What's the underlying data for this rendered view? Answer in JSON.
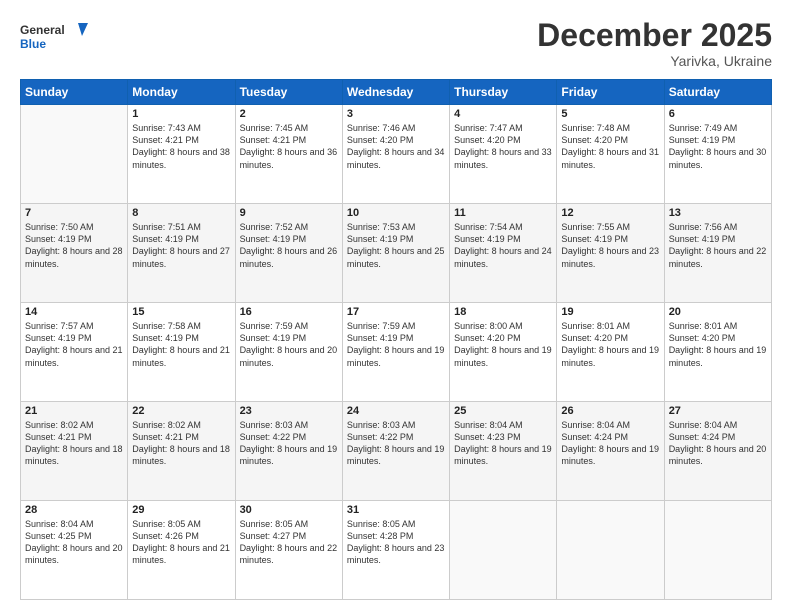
{
  "header": {
    "logo_line1": "General",
    "logo_line2": "Blue",
    "title": "December 2025",
    "subtitle": "Yarivka, Ukraine"
  },
  "days_of_week": [
    "Sunday",
    "Monday",
    "Tuesday",
    "Wednesday",
    "Thursday",
    "Friday",
    "Saturday"
  ],
  "weeks": [
    [
      {
        "day": "",
        "sunrise": "",
        "sunset": "",
        "daylight": ""
      },
      {
        "day": "1",
        "sunrise": "Sunrise: 7:43 AM",
        "sunset": "Sunset: 4:21 PM",
        "daylight": "Daylight: 8 hours and 38 minutes."
      },
      {
        "day": "2",
        "sunrise": "Sunrise: 7:45 AM",
        "sunset": "Sunset: 4:21 PM",
        "daylight": "Daylight: 8 hours and 36 minutes."
      },
      {
        "day": "3",
        "sunrise": "Sunrise: 7:46 AM",
        "sunset": "Sunset: 4:20 PM",
        "daylight": "Daylight: 8 hours and 34 minutes."
      },
      {
        "day": "4",
        "sunrise": "Sunrise: 7:47 AM",
        "sunset": "Sunset: 4:20 PM",
        "daylight": "Daylight: 8 hours and 33 minutes."
      },
      {
        "day": "5",
        "sunrise": "Sunrise: 7:48 AM",
        "sunset": "Sunset: 4:20 PM",
        "daylight": "Daylight: 8 hours and 31 minutes."
      },
      {
        "day": "6",
        "sunrise": "Sunrise: 7:49 AM",
        "sunset": "Sunset: 4:19 PM",
        "daylight": "Daylight: 8 hours and 30 minutes."
      }
    ],
    [
      {
        "day": "7",
        "sunrise": "Sunrise: 7:50 AM",
        "sunset": "Sunset: 4:19 PM",
        "daylight": "Daylight: 8 hours and 28 minutes."
      },
      {
        "day": "8",
        "sunrise": "Sunrise: 7:51 AM",
        "sunset": "Sunset: 4:19 PM",
        "daylight": "Daylight: 8 hours and 27 minutes."
      },
      {
        "day": "9",
        "sunrise": "Sunrise: 7:52 AM",
        "sunset": "Sunset: 4:19 PM",
        "daylight": "Daylight: 8 hours and 26 minutes."
      },
      {
        "day": "10",
        "sunrise": "Sunrise: 7:53 AM",
        "sunset": "Sunset: 4:19 PM",
        "daylight": "Daylight: 8 hours and 25 minutes."
      },
      {
        "day": "11",
        "sunrise": "Sunrise: 7:54 AM",
        "sunset": "Sunset: 4:19 PM",
        "daylight": "Daylight: 8 hours and 24 minutes."
      },
      {
        "day": "12",
        "sunrise": "Sunrise: 7:55 AM",
        "sunset": "Sunset: 4:19 PM",
        "daylight": "Daylight: 8 hours and 23 minutes."
      },
      {
        "day": "13",
        "sunrise": "Sunrise: 7:56 AM",
        "sunset": "Sunset: 4:19 PM",
        "daylight": "Daylight: 8 hours and 22 minutes."
      }
    ],
    [
      {
        "day": "14",
        "sunrise": "Sunrise: 7:57 AM",
        "sunset": "Sunset: 4:19 PM",
        "daylight": "Daylight: 8 hours and 21 minutes."
      },
      {
        "day": "15",
        "sunrise": "Sunrise: 7:58 AM",
        "sunset": "Sunset: 4:19 PM",
        "daylight": "Daylight: 8 hours and 21 minutes."
      },
      {
        "day": "16",
        "sunrise": "Sunrise: 7:59 AM",
        "sunset": "Sunset: 4:19 PM",
        "daylight": "Daylight: 8 hours and 20 minutes."
      },
      {
        "day": "17",
        "sunrise": "Sunrise: 7:59 AM",
        "sunset": "Sunset: 4:19 PM",
        "daylight": "Daylight: 8 hours and 19 minutes."
      },
      {
        "day": "18",
        "sunrise": "Sunrise: 8:00 AM",
        "sunset": "Sunset: 4:20 PM",
        "daylight": "Daylight: 8 hours and 19 minutes."
      },
      {
        "day": "19",
        "sunrise": "Sunrise: 8:01 AM",
        "sunset": "Sunset: 4:20 PM",
        "daylight": "Daylight: 8 hours and 19 minutes."
      },
      {
        "day": "20",
        "sunrise": "Sunrise: 8:01 AM",
        "sunset": "Sunset: 4:20 PM",
        "daylight": "Daylight: 8 hours and 19 minutes."
      }
    ],
    [
      {
        "day": "21",
        "sunrise": "Sunrise: 8:02 AM",
        "sunset": "Sunset: 4:21 PM",
        "daylight": "Daylight: 8 hours and 18 minutes."
      },
      {
        "day": "22",
        "sunrise": "Sunrise: 8:02 AM",
        "sunset": "Sunset: 4:21 PM",
        "daylight": "Daylight: 8 hours and 18 minutes."
      },
      {
        "day": "23",
        "sunrise": "Sunrise: 8:03 AM",
        "sunset": "Sunset: 4:22 PM",
        "daylight": "Daylight: 8 hours and 19 minutes."
      },
      {
        "day": "24",
        "sunrise": "Sunrise: 8:03 AM",
        "sunset": "Sunset: 4:22 PM",
        "daylight": "Daylight: 8 hours and 19 minutes."
      },
      {
        "day": "25",
        "sunrise": "Sunrise: 8:04 AM",
        "sunset": "Sunset: 4:23 PM",
        "daylight": "Daylight: 8 hours and 19 minutes."
      },
      {
        "day": "26",
        "sunrise": "Sunrise: 8:04 AM",
        "sunset": "Sunset: 4:24 PM",
        "daylight": "Daylight: 8 hours and 19 minutes."
      },
      {
        "day": "27",
        "sunrise": "Sunrise: 8:04 AM",
        "sunset": "Sunset: 4:24 PM",
        "daylight": "Daylight: 8 hours and 20 minutes."
      }
    ],
    [
      {
        "day": "28",
        "sunrise": "Sunrise: 8:04 AM",
        "sunset": "Sunset: 4:25 PM",
        "daylight": "Daylight: 8 hours and 20 minutes."
      },
      {
        "day": "29",
        "sunrise": "Sunrise: 8:05 AM",
        "sunset": "Sunset: 4:26 PM",
        "daylight": "Daylight: 8 hours and 21 minutes."
      },
      {
        "day": "30",
        "sunrise": "Sunrise: 8:05 AM",
        "sunset": "Sunset: 4:27 PM",
        "daylight": "Daylight: 8 hours and 22 minutes."
      },
      {
        "day": "31",
        "sunrise": "Sunrise: 8:05 AM",
        "sunset": "Sunset: 4:28 PM",
        "daylight": "Daylight: 8 hours and 23 minutes."
      },
      {
        "day": "",
        "sunrise": "",
        "sunset": "",
        "daylight": ""
      },
      {
        "day": "",
        "sunrise": "",
        "sunset": "",
        "daylight": ""
      },
      {
        "day": "",
        "sunrise": "",
        "sunset": "",
        "daylight": ""
      }
    ]
  ]
}
